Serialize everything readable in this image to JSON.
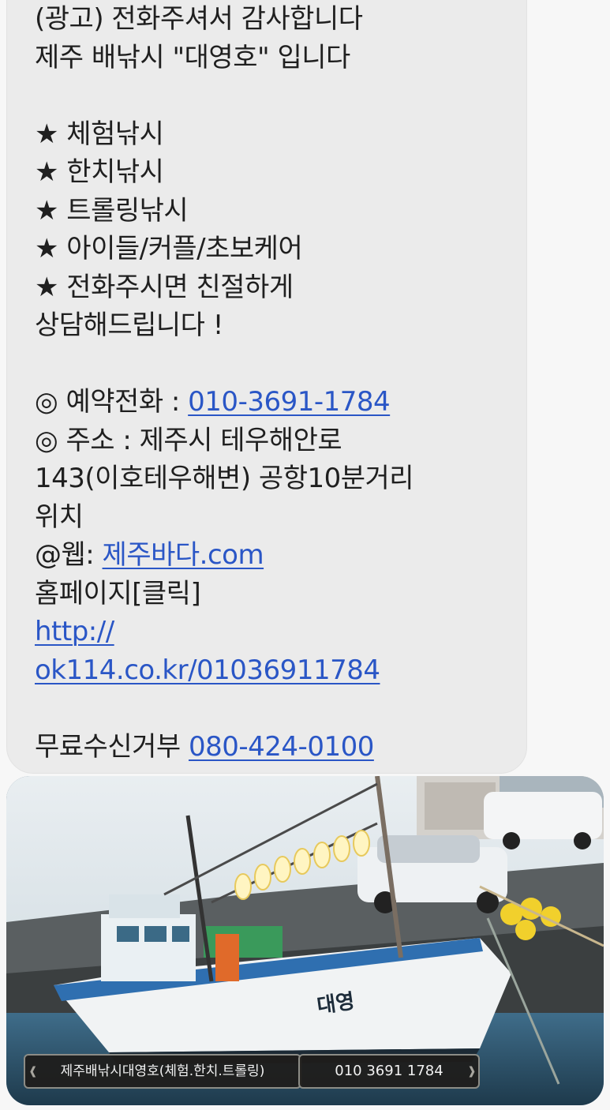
{
  "message": {
    "line1": "(광고) 전화주셔서 감사합니다",
    "line2": "제주 배낚시 \"대영호\" 입니다",
    "services": [
      "★ 체험낚시",
      "★ 한치낚시",
      "★ 트롤링낚시",
      "★ 아이들/커플/초보케어",
      "★ 전화주시면 친절하게"
    ],
    "consult": "상담해드립니다 !",
    "reservation_label": "◎ 예약전화 : ",
    "reservation_phone": "010-3691-1784",
    "address_line1": "◎ 주소 : 제주시 테우해안로",
    "address_line2": "143(이호테우해변) 공항10분거리",
    "address_line3": "위치",
    "web_label": "@웹: ",
    "web_link": "제주바다.com",
    "homepage_label": "홈페이지[클릭]",
    "homepage_url_1": "http://",
    "homepage_url_2": "ok114.co.kr/01036911784",
    "optout_label": "무료수신거부 ",
    "optout_phone": "080-424-0100"
  },
  "photo": {
    "caption_left": "제주배낚시대영호(체험.한치.트롤링)",
    "caption_right": "010 3691 1784",
    "hull_text": "대영"
  },
  "colors": {
    "link": "#2a56c6",
    "bubble": "#ebebeb",
    "background": "#f7f7f7"
  }
}
